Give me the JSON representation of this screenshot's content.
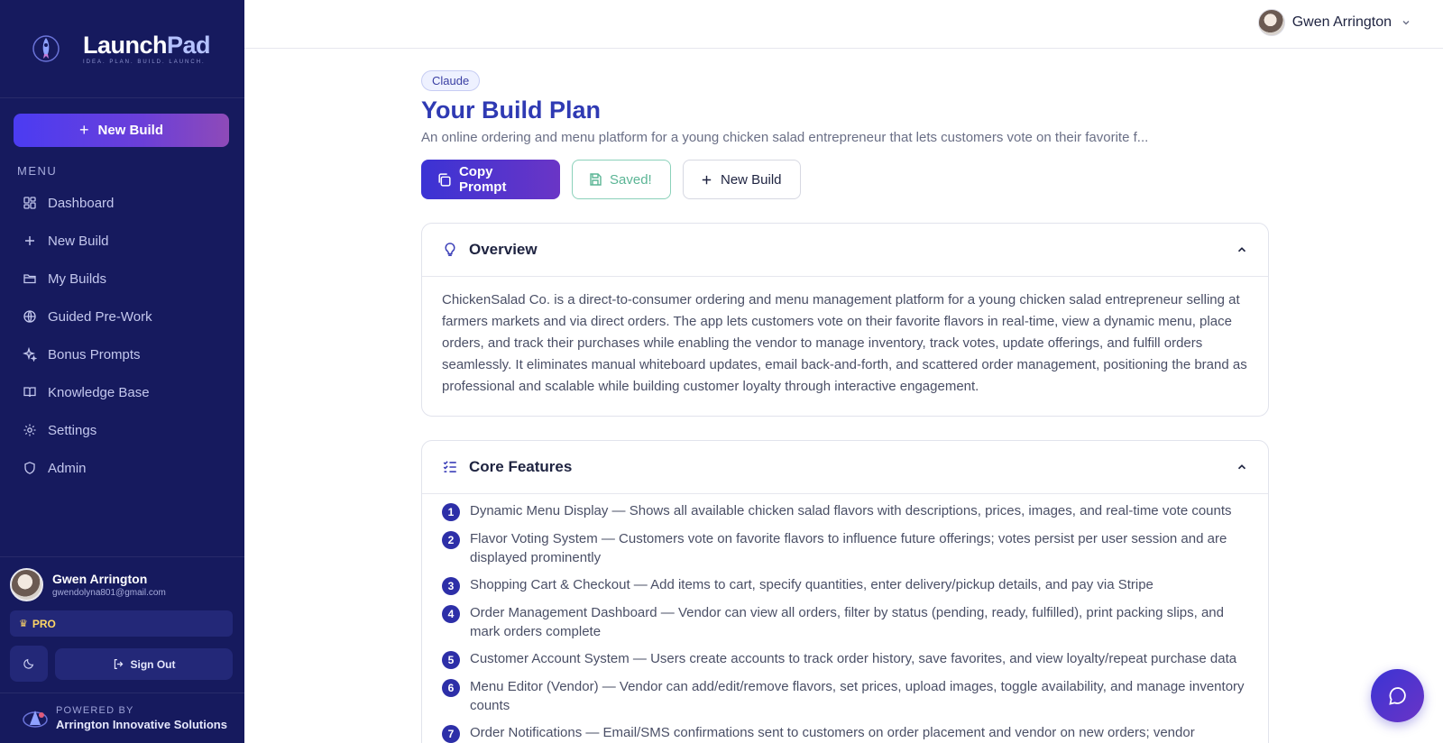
{
  "brand": {
    "name_part1": "Launch",
    "name_part2": "Pad",
    "tagline": "IDEA. PLAN. BUILD. LAUNCH."
  },
  "sidebar": {
    "new_build_label": "New Build",
    "menu_label": "MENU",
    "items": [
      {
        "label": "Dashboard",
        "icon": "dashboard-icon"
      },
      {
        "label": "New Build",
        "icon": "plus-icon"
      },
      {
        "label": "My Builds",
        "icon": "folder-icon"
      },
      {
        "label": "Guided Pre-Work",
        "icon": "globe-icon"
      },
      {
        "label": "Bonus Prompts",
        "icon": "sparkle-icon"
      },
      {
        "label": "Knowledge Base",
        "icon": "book-icon"
      },
      {
        "label": "Settings",
        "icon": "gear-icon"
      },
      {
        "label": "Admin",
        "icon": "shield-icon"
      }
    ],
    "user": {
      "name": "Gwen Arrington",
      "email": "gwendolyna801@gmail.com"
    },
    "plan_badge": "PRO",
    "sign_out_label": "Sign Out",
    "powered_by_label": "POWERED BY",
    "powered_by_org": "Arrington Innovative Solutions"
  },
  "topbar": {
    "user_name": "Gwen Arrington"
  },
  "main": {
    "model_badge": "Claude",
    "title": "Your Build Plan",
    "subtitle": "An online ordering and menu platform for a young chicken salad entrepreneur that lets customers vote on their favorite f...",
    "actions": {
      "copy_prompt": "Copy Prompt",
      "saved": "Saved!",
      "new_build": "New Build"
    },
    "overview": {
      "title": "Overview",
      "body": "ChickenSalad Co. is a direct-to-consumer ordering and menu management platform for a young chicken salad entrepreneur selling at farmers markets and via direct orders. The app lets customers vote on their favorite flavors in real-time, view a dynamic menu, place orders, and track their purchases while enabling the vendor to manage inventory, track votes, update offerings, and fulfill orders seamlessly. It eliminates manual whiteboard updates, email back-and-forth, and scattered order management, positioning the brand as professional and scalable while building customer loyalty through interactive engagement."
    },
    "core_features": {
      "title": "Core Features",
      "items": [
        {
          "num": "1",
          "text": "Dynamic Menu Display — Shows all available chicken salad flavors with descriptions, prices, images, and real-time vote counts"
        },
        {
          "num": "2",
          "text": "Flavor Voting System — Customers vote on favorite flavors to influence future offerings; votes persist per user session and are displayed prominently"
        },
        {
          "num": "3",
          "text": "Shopping Cart & Checkout — Add items to cart, specify quantities, enter delivery/pickup details, and pay via Stripe"
        },
        {
          "num": "4",
          "text": "Order Management Dashboard — Vendor can view all orders, filter by status (pending, ready, fulfilled), print packing slips, and mark orders complete"
        },
        {
          "num": "5",
          "text": "Customer Account System — Users create accounts to track order history, save favorites, and view loyalty/repeat purchase data"
        },
        {
          "num": "6",
          "text": "Menu Editor (Vendor) — Vendor can add/edit/remove flavors, set prices, upload images, toggle availability, and manage inventory counts"
        },
        {
          "num": "7",
          "text": "Order Notifications — Email/SMS confirmations sent to customers on order placement and vendor on new orders; vendor"
        }
      ]
    }
  },
  "colors": {
    "sidebar_bg": "#161a5e",
    "accent": "#3b33d4",
    "title": "#2f3ab3",
    "saved": "#5bb595"
  }
}
